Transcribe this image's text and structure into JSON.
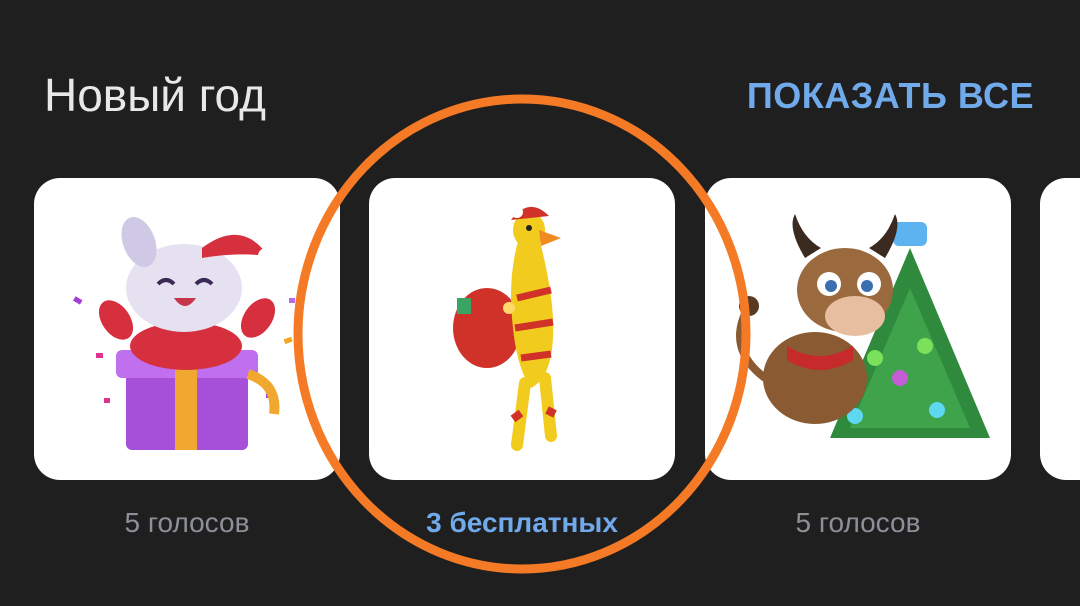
{
  "section": {
    "title": "Новый год",
    "show_all_label": "ПОКАЗАТЬ ВСЕ"
  },
  "stickers": [
    {
      "name": "cat-in-gift-box",
      "caption": "5 голосов",
      "caption_color": "#8d9096"
    },
    {
      "name": "rubber-chicken-2022",
      "caption": "3 бесплатных",
      "caption_color": "#71aaeb"
    },
    {
      "name": "bull-with-christmas-tree",
      "caption": "5 голосов",
      "caption_color": "#8d9096"
    }
  ],
  "colors": {
    "background": "#1f1f20",
    "accent": "#71aaeb",
    "highlight_ring": "#f57a26"
  }
}
